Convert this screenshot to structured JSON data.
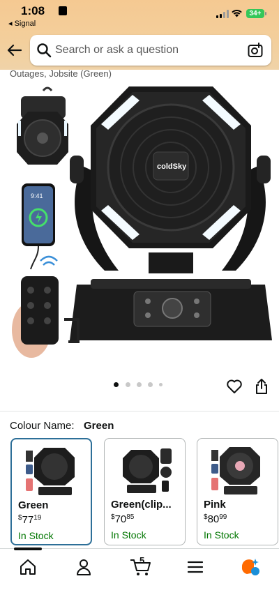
{
  "status_bar": {
    "time": "1:08",
    "back_app": "◂ Signal",
    "battery": "34+"
  },
  "search": {
    "placeholder": "Search or ask a question"
  },
  "product": {
    "title_fragment": "Outages, Jobsite (Green)",
    "brand_on_image": "coldSky",
    "phone_time_on_image": "9:41",
    "gallery_dots": 5,
    "active_dot": 0
  },
  "variant": {
    "label": "Colour Name:",
    "selected": "Green",
    "options": [
      {
        "name": "Green",
        "currency": "$",
        "dollars": "77",
        "cents": "19",
        "stock": "In Stock",
        "selected": true
      },
      {
        "name": "Green(clip...",
        "currency": "$",
        "dollars": "70",
        "cents": "85",
        "stock": "In Stock",
        "selected": false
      },
      {
        "name": "Pink",
        "currency": "$",
        "dollars": "80",
        "cents": "99",
        "stock": "In Stock",
        "selected": false
      }
    ]
  },
  "bottom_nav": {
    "items": [
      "home-icon",
      "account-icon",
      "cart-icon",
      "menu-icon",
      "rufus-icon"
    ],
    "cart_count": "5"
  },
  "colors": {
    "header_gradient": "#f5c992",
    "selected_border": "#2d6f98",
    "in_stock": "#007600",
    "accent_orange": "#ff6a00"
  }
}
